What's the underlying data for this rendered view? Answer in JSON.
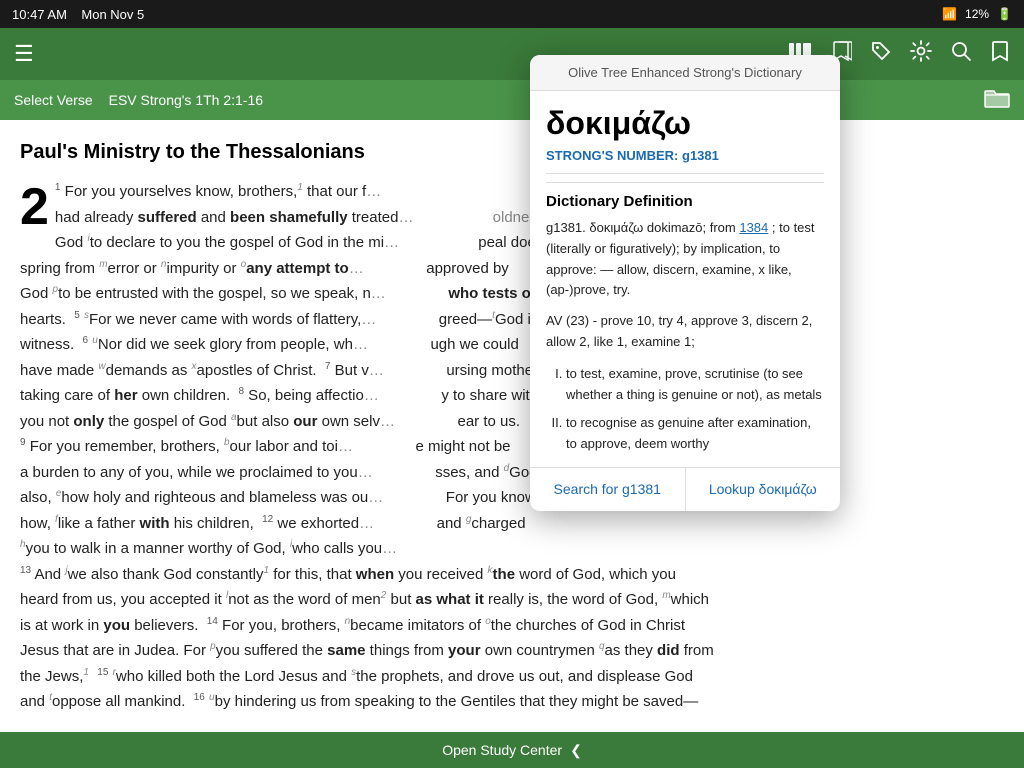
{
  "statusBar": {
    "time": "10:47 AM",
    "date": "Mon Nov 5",
    "wifi": "wifi-icon",
    "battery": "12%"
  },
  "toolbar": {
    "menuIcon": "☰",
    "booksIcon": "📚",
    "bookmarkListIcon": "🔖",
    "bookmarkIcon": "🔖",
    "settingsIcon": "⚙",
    "searchIcon": "🔍",
    "addBookmarkIcon": "🔖"
  },
  "navBar": {
    "selectVerseLabel": "Select Verse",
    "reference": "ESV Strong's 1Th 2:1-16",
    "folderIcon": "folder-icon"
  },
  "bibleContent": {
    "title": "Paul's Ministry to the Thessalonians",
    "chapterNum": "2",
    "text": "Full bible passage text"
  },
  "bottomBar": {
    "label": "Open Study Center",
    "arrowIcon": "❮"
  },
  "dictPopup": {
    "headerTitle": "Olive Tree Enhanced Strong's Dictionary",
    "greekWord": "δοκιμάζω",
    "strongsLabel": "STRONG'S NUMBER:",
    "strongsNumber": "g1381",
    "defTitle": "Dictionary Definition",
    "defBody": "g1381. δοκιμάζω dokimazō; from",
    "defLink": "1384",
    "defBody2": "; to test (literally or figuratively); by implication, to approve: — allow, discern, examine, x like, (ap-)prove, try.",
    "avText": "AV (23) - prove 10, try 4, approve 3, discern 2, allow 2, like 1, examine 1;",
    "listItems": [
      "to test, examine, prove, scrutinise (to see whether a thing is genuine or not), as metals",
      "to recognise as genuine after examination, to approve, deem worthy"
    ],
    "searchLabel": "Search for g1381",
    "lookupLabel": "Lookup δοκιμάζω"
  }
}
